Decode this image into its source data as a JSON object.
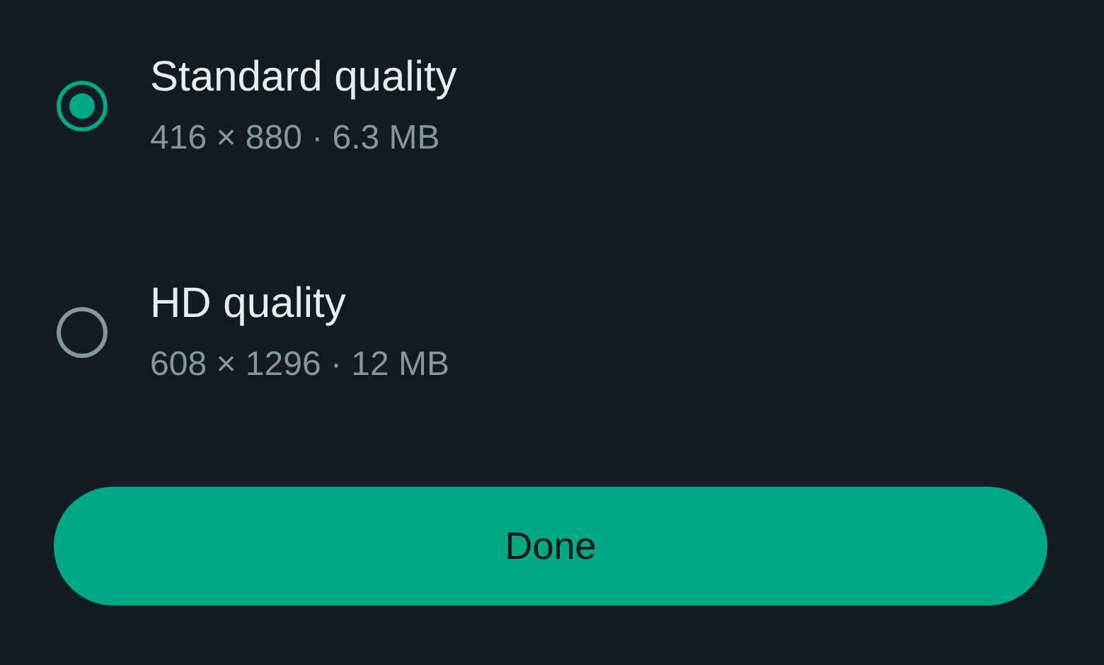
{
  "options": [
    {
      "title": "Standard quality",
      "detail": "416 × 880 · 6.3 MB",
      "selected": true
    },
    {
      "title": "HD quality",
      "detail": "608 × 1296 · 12 MB",
      "selected": false
    }
  ],
  "button": "Done"
}
